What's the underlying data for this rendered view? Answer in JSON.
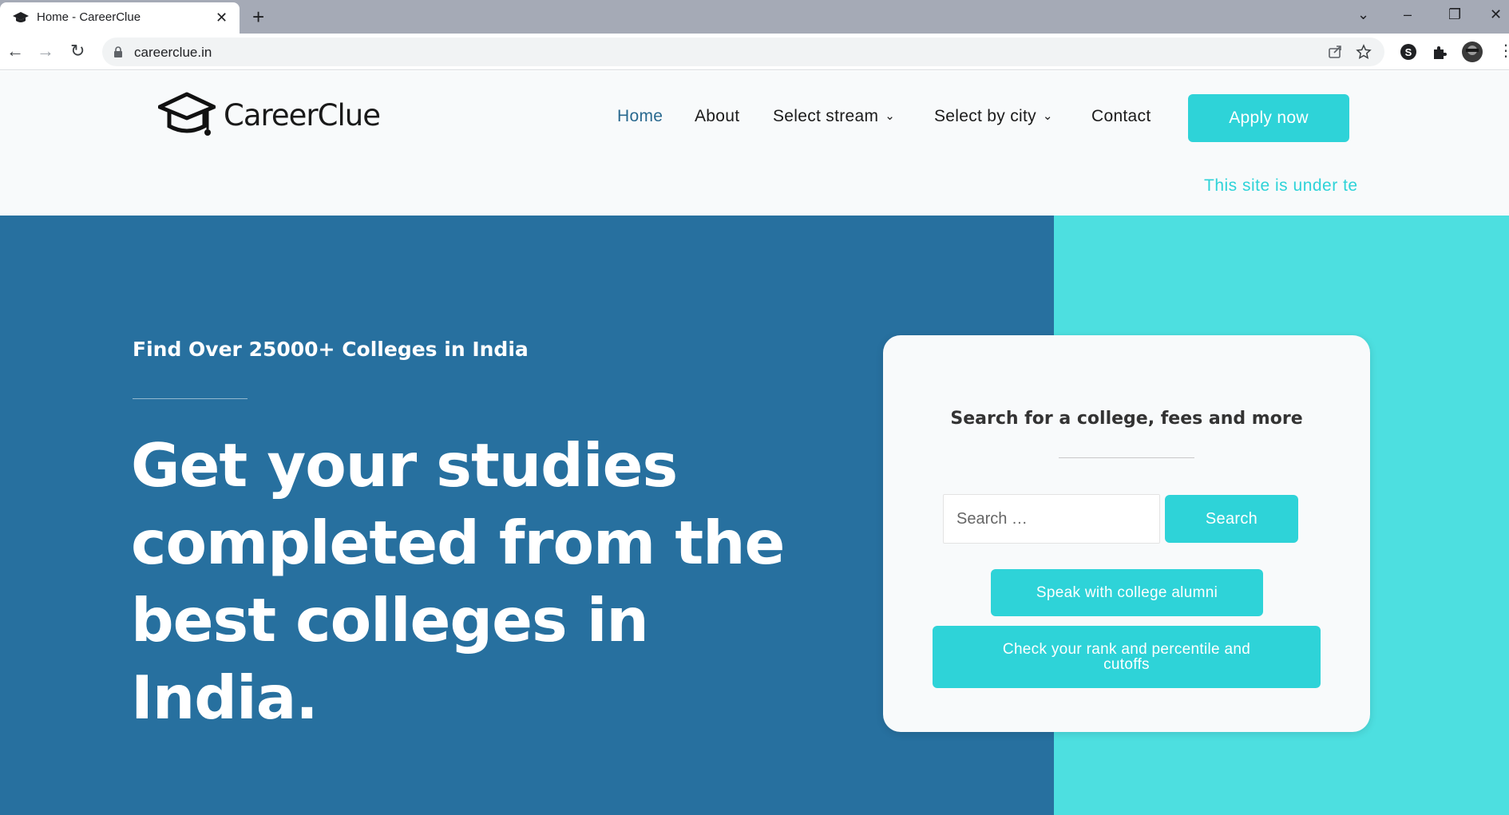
{
  "browser": {
    "tab_title": "Home - CareerClue",
    "tab_close": "✕",
    "new_tab": "+",
    "url": "careerclue.in",
    "window_controls": {
      "dropdown": "⌄",
      "minimize": "–",
      "restore": "❐",
      "close": "✕"
    },
    "nav": {
      "back": "←",
      "forward": "→",
      "reload": "↻"
    },
    "omnibox_icons": [
      "share-icon",
      "star-icon"
    ],
    "extensions": [
      "skype-extension-icon",
      "puzzle-extensions-icon",
      "profile-avatar"
    ],
    "menu_icon": "⋮"
  },
  "header": {
    "logo_text": "CareerClue",
    "nav": [
      {
        "label": "Home",
        "active": true
      },
      {
        "label": "About"
      },
      {
        "label": "Select stream",
        "dropdown": true
      },
      {
        "label": "Select by city",
        "dropdown": true
      },
      {
        "label": "Contact"
      }
    ],
    "apply_button": "Apply now",
    "marquee_text": "This site is under te"
  },
  "hero": {
    "subtitle": "Find Over 25000+ Colleges in India",
    "title": "Get your studies completed from the best colleges in India."
  },
  "search_card": {
    "title": "Search for a college, fees and more",
    "search_placeholder": "Search …",
    "search_button": "Search",
    "alumni_button": "Speak with college alumni",
    "rank_button": "Check your rank and percentile and cutoffs"
  },
  "colors": {
    "accent": "#2ed3d8",
    "hero_blue": "#27709f",
    "hero_cyan": "#4ddfe0",
    "nav_active": "#29698f"
  }
}
